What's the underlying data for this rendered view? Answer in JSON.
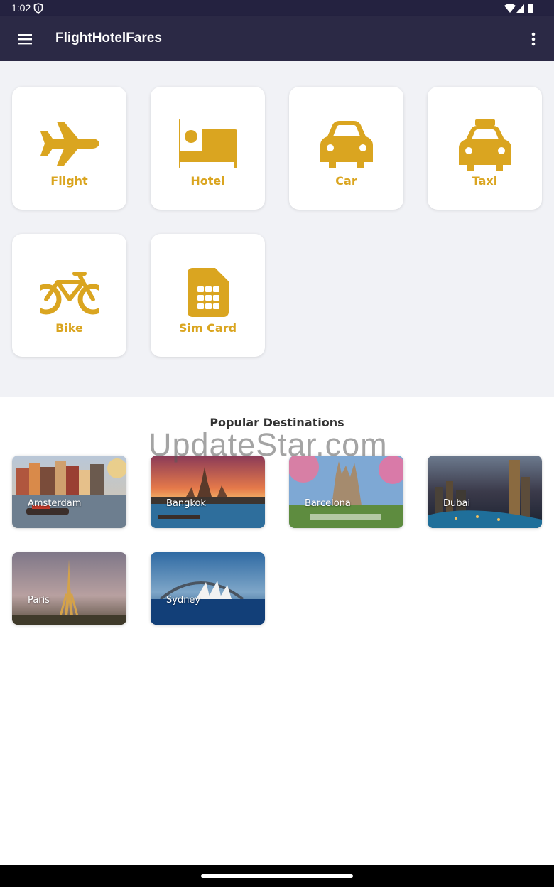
{
  "status_bar": {
    "time": "1:02"
  },
  "app_bar": {
    "title": "FlightHotelFares"
  },
  "services": [
    {
      "label": "Flight",
      "icon": "airplane-icon"
    },
    {
      "label": "Hotel",
      "icon": "bed-icon"
    },
    {
      "label": "Car",
      "icon": "car-icon"
    },
    {
      "label": "Taxi",
      "icon": "taxi-icon"
    },
    {
      "label": "Bike",
      "icon": "bicycle-icon"
    },
    {
      "label": "Sim Card",
      "icon": "sim-card-icon"
    }
  ],
  "popular": {
    "title": "Popular Destinations",
    "destinations": [
      {
        "name": "Amsterdam"
      },
      {
        "name": "Bangkok"
      },
      {
        "name": "Barcelona"
      },
      {
        "name": "Dubai"
      },
      {
        "name": "Paris"
      },
      {
        "name": "Sydney"
      }
    ]
  },
  "watermark": "UpdateStar.com",
  "colors": {
    "accent": "#daa520",
    "app_bar": "#2b2945",
    "background": "#f1f2f6"
  }
}
